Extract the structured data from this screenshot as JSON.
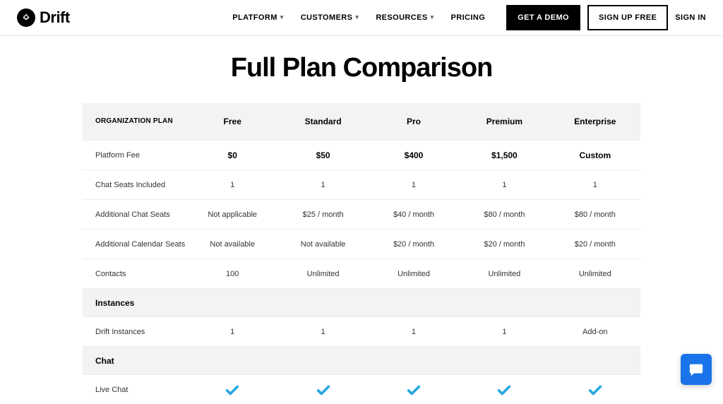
{
  "brand": "Drift",
  "nav": {
    "items": [
      {
        "label": "PLATFORM",
        "dropdown": true
      },
      {
        "label": "CUSTOMERS",
        "dropdown": true
      },
      {
        "label": "RESOURCES",
        "dropdown": true
      },
      {
        "label": "PRICING",
        "dropdown": false
      }
    ],
    "demo": "GET A DEMO",
    "signup": "SIGN UP FREE",
    "signin": "SIGN IN"
  },
  "title": "Full Plan Comparison",
  "table": {
    "header_label": "ORGANIZATION PLAN",
    "plans": [
      "Free",
      "Standard",
      "Pro",
      "Premium",
      "Enterprise"
    ],
    "rows": [
      {
        "label": "Platform Fee",
        "bold": true,
        "values": [
          "$0",
          "$50",
          "$400",
          "$1,500",
          "Custom"
        ]
      },
      {
        "label": "Chat Seats Included",
        "values": [
          "1",
          "1",
          "1",
          "1",
          "1"
        ]
      },
      {
        "label": "Additional Chat Seats",
        "values": [
          "Not applicable",
          "$25 / month",
          "$40 / month",
          "$80 / month",
          "$80 / month"
        ]
      },
      {
        "label": "Additional Calendar Seats",
        "values": [
          "Not available",
          "Not available",
          "$20 / month",
          "$20 / month",
          "$20 / month"
        ]
      },
      {
        "label": "Contacts",
        "values": [
          "100",
          "Unlimited",
          "Unlimited",
          "Unlimited",
          "Unlimited"
        ]
      }
    ],
    "section_instances": "Instances",
    "instances_row": {
      "label": "Drift Instances",
      "values": [
        "1",
        "1",
        "1",
        "1",
        "Add-on"
      ]
    },
    "section_chat": "Chat",
    "chat_row": {
      "label": "Live Chat",
      "checks": [
        true,
        true,
        true,
        true,
        true
      ]
    }
  }
}
